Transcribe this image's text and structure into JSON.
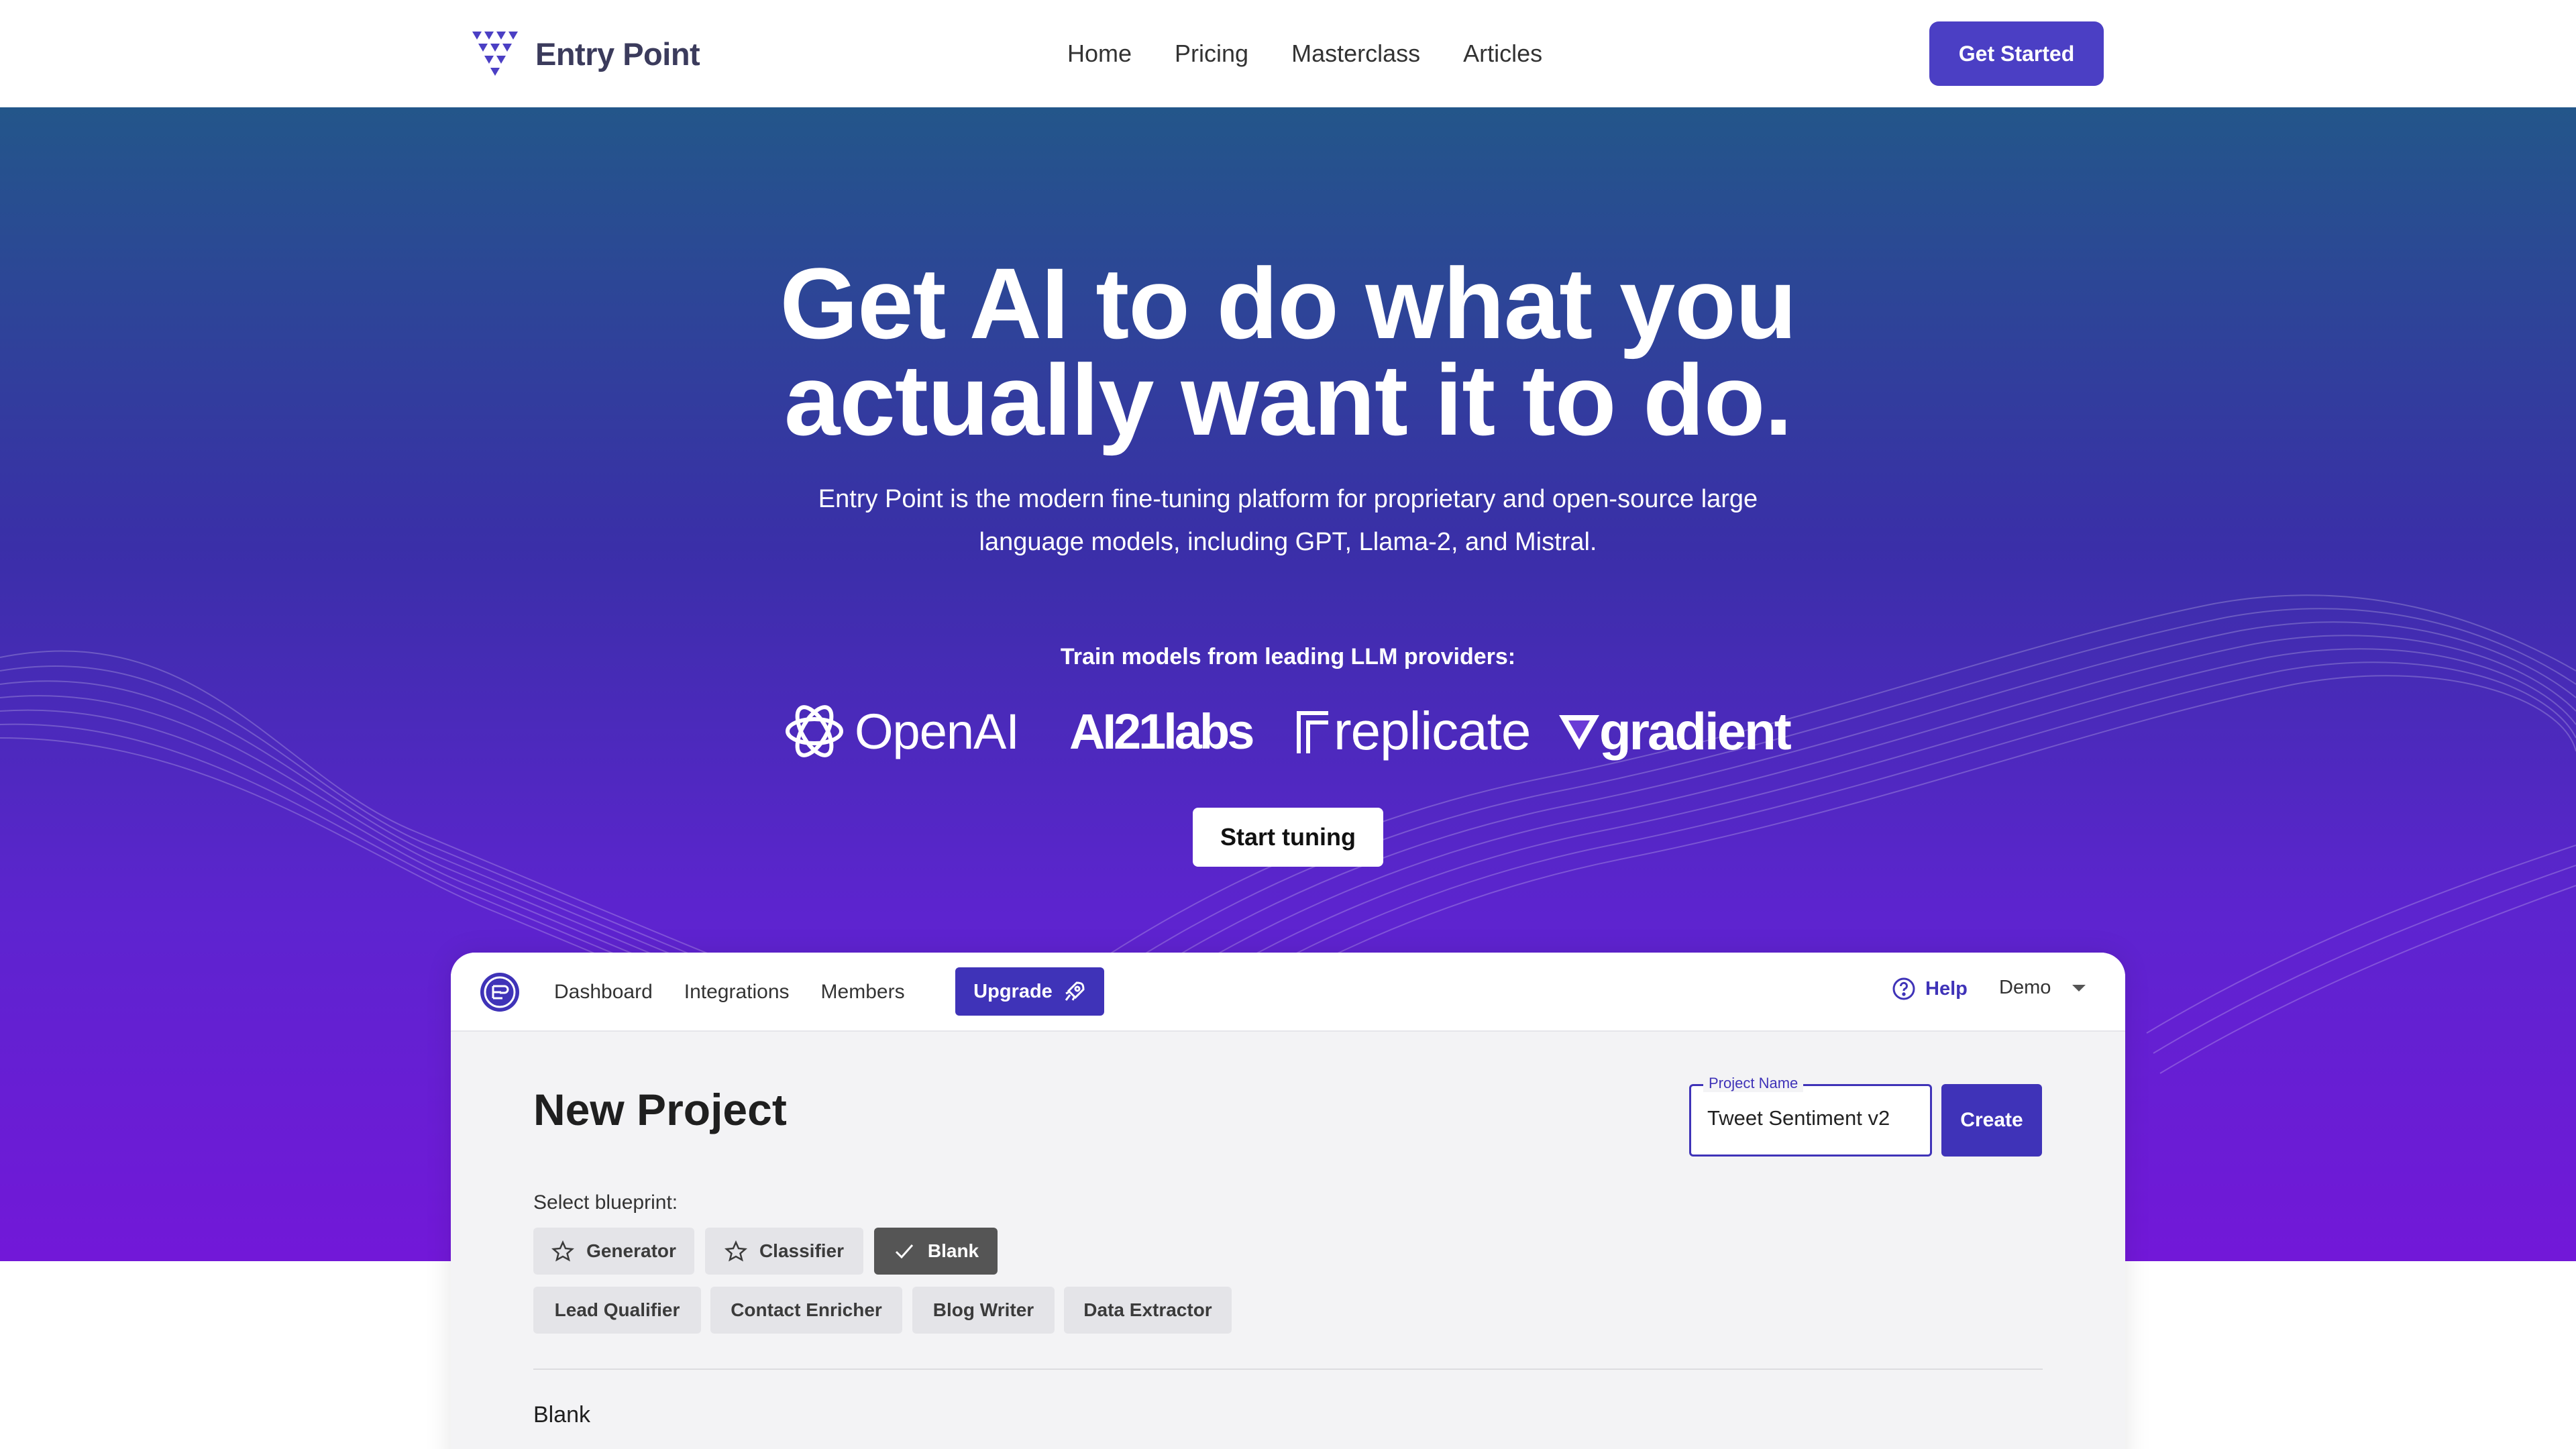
{
  "brand": {
    "name": "Entry Point"
  },
  "nav": {
    "links": [
      "Home",
      "Pricing",
      "Masterclass",
      "Articles"
    ],
    "cta": "Get Started"
  },
  "hero": {
    "headline_line1": "Get AI to do what you",
    "headline_line2": "actually want it to do.",
    "subhead": "Entry Point is the modern fine-tuning platform for proprietary and open-source large language models, including GPT, Llama-2, and Mistral.",
    "providers_label": "Train models from leading LLM providers:",
    "providers": [
      "OpenAI",
      "AI21labs",
      "replicate",
      "gradient"
    ],
    "cta": "Start tuning",
    "colors": {
      "gradient_top": "#23568a",
      "gradient_mid": "#3a2fa8",
      "gradient_bottom": "#7218d8"
    }
  },
  "app": {
    "nav": [
      "Dashboard",
      "Integrations",
      "Members"
    ],
    "upgrade_label": "Upgrade",
    "help_label": "Help",
    "account_label": "Demo",
    "page_title": "New Project",
    "project_name_label": "Project Name",
    "project_name_value": "Tweet Sentiment v2",
    "create_label": "Create",
    "blueprint_label": "Select blueprint:",
    "blueprints": [
      "Generator",
      "Classifier",
      "Blank",
      "Lead Qualifier",
      "Contact Enricher",
      "Blog Writer",
      "Data Extractor"
    ],
    "selected_blueprint": "Blank",
    "section_title": "Blank",
    "accent_color": "#3f33b8"
  }
}
